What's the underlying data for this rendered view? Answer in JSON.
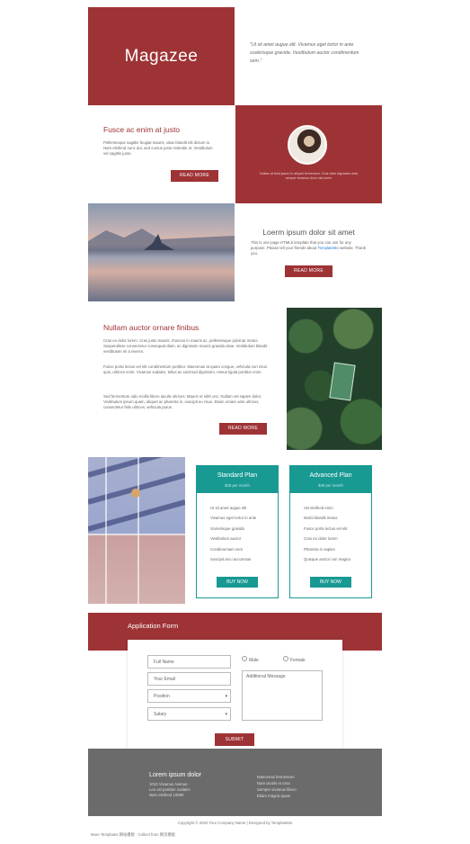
{
  "hero": {
    "brand": "Magazee",
    "quote": "\"Ut sit amet augue elit. Vivamus eget tortor in ante scelerisque gravida. Vestibulum auctor condimentum sem.\""
  },
  "section_fusce": {
    "title": "Fusce ac enim at justo",
    "text": "Pellentesque sagittis feugiat mauris, vitae blandit elit dictum in. Nam eleifend nunc dui, sed cursus justo molestie ut. Vestibulum vel sagittis justo.",
    "button": "READ MORE"
  },
  "profile": {
    "caption": "Nullam at feist ipsum in aliquet fermentum. Cras vitae dignissim ante, semper vivamus dolor nisi lorem."
  },
  "section_lorem": {
    "title": "Loerm ipsum dolor sit amet",
    "text_before": "This is one-page HTML5 template that you can use for any purpose. Please tell your friends about ",
    "link": "TemplateMo",
    "text_after": " website. Thank you.",
    "button": "READ MORE"
  },
  "section_nullam": {
    "title": "Nullam auctor ornare finibus",
    "para1": "Cras eu dolor lorem. Cras justo mauris, rhoncus in mauris ac, pellentesque pulvinar metus. Suspendisse consectetur consequat diam, ac dignissim mauris gravida vitae. Vestibulum blandit vestibulum mi a viverra.",
    "para2": "Fusce porta lectus vel elit condimentum porttitor. Maecenas at quam congue, vehicula non risus quis, ultrices enim. Vivamus sodales, tellus ac euismod dignissim, metus ligula porttitor enim.",
    "para3": "Sed fermentum odio mollis libero iaculis ultrices. Mauris et nibh orci. Nullam vel sapien dolor. Vestibulum ipsum quam, aliquet ac pharetra in, suscipit eu risus. Etiam ornare ante ultrices, consectetur felis ultrices, vehicula purus.",
    "button": "READ MORE"
  },
  "plans": [
    {
      "name": "Standard Plan",
      "price": "$29 per month",
      "features": [
        "Ut sit amet augue elit",
        "Vivamus eget tortor in ante",
        "Scelerisque gravida",
        "Vestibulum auctor",
        "Condimentum sem",
        "Suscipit arcu accumsan"
      ],
      "button": "BUY NOW"
    },
    {
      "name": "Advanced Plan",
      "price": "$49 per month",
      "features": [
        "Vel eleifend enim",
        "Morbi blandit metus",
        "Fusce porta lectus vel elit",
        "Cras eu dolor lorem",
        "Pharetra in sapien",
        "Quisque auctor non magna"
      ],
      "button": "BUY NOW"
    }
  ],
  "form": {
    "title": "Application Form",
    "full_name": "Full Name",
    "email": "Your Email",
    "position": "Position",
    "salary": "Salary",
    "male": "Male",
    "female": "Female",
    "message": "Additional Message",
    "submit": "SUBMIT"
  },
  "footer": {
    "title": "Lorem ipsum dolor",
    "left_lines": [
      "1010 Vivamus Avenue",
      "Leo vel porttitor sodales",
      "Nam eleifend 10080"
    ],
    "right_lines": [
      "Maecenas fermentum",
      "Nam iaculis et urna",
      "Semper vivamus libero",
      "Etiam magna quam"
    ],
    "copyright": "Copyright © 2022 Your Company Name | Designed by TemplateMo",
    "credits": "More Templates 网站模板 - Collect from 网页模板"
  },
  "colors": {
    "maroon": "#9e3336",
    "teal": "#189a93",
    "footer_gray": "#6b6b6b"
  }
}
